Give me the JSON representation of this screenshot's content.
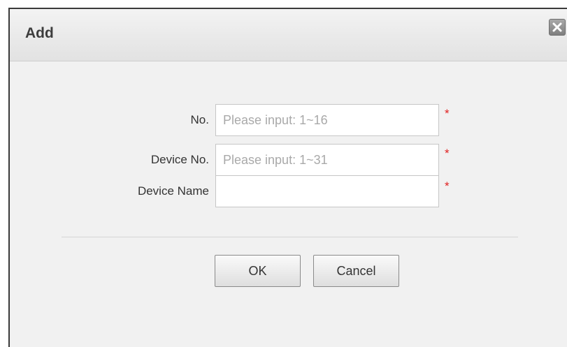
{
  "dialog": {
    "title": "Add",
    "close_icon": "close-icon"
  },
  "form": {
    "fields": [
      {
        "label": "No.",
        "value": "",
        "placeholder": "Please input: 1~16",
        "required_mark": "*"
      },
      {
        "label": "Device No.",
        "value": "",
        "placeholder": "Please input: 1~31",
        "required_mark": "*"
      },
      {
        "label": "Device Name",
        "value": "",
        "placeholder": "",
        "required_mark": "*"
      }
    ]
  },
  "buttons": {
    "ok_label": "OK",
    "cancel_label": "Cancel"
  },
  "colors": {
    "required": "#e02020",
    "title_text": "#3d3d3d",
    "dialog_background": "#f1f1f1"
  }
}
